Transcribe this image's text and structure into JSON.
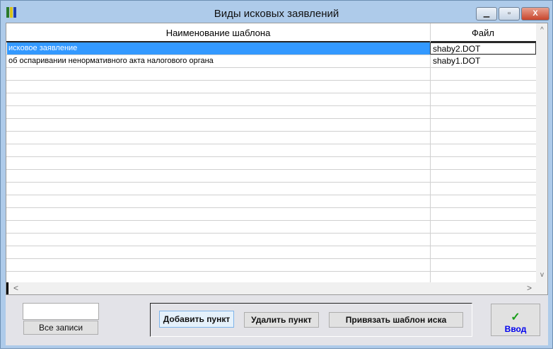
{
  "window": {
    "title": "Виды исковых заявлений",
    "minimize": "▁",
    "maximize": "▫",
    "close": "X"
  },
  "grid": {
    "headers": [
      "Наименование шаблона",
      "Файл"
    ],
    "rows": [
      {
        "name": "исковое заявление",
        "file": "shaby2.DOT",
        "selected": true
      },
      {
        "name": "об оспаривании ненормативного акта налогового органа",
        "file": "shaby1.DOT",
        "selected": false
      }
    ],
    "empty_rows": 17
  },
  "scroll": {
    "up": "^",
    "down": "v",
    "left": "<",
    "right": ">"
  },
  "bottom": {
    "filter_value": "",
    "all_records": "Все записи",
    "add": "Добавить пункт",
    "delete": "Удалить пункт",
    "attach": "Привязать шаблон иска",
    "enter_icon": "✓",
    "enter": "Ввод"
  },
  "colors": {
    "selection": "#3399ff",
    "enter_text": "#0000ee",
    "check": "#1a9e1a"
  }
}
